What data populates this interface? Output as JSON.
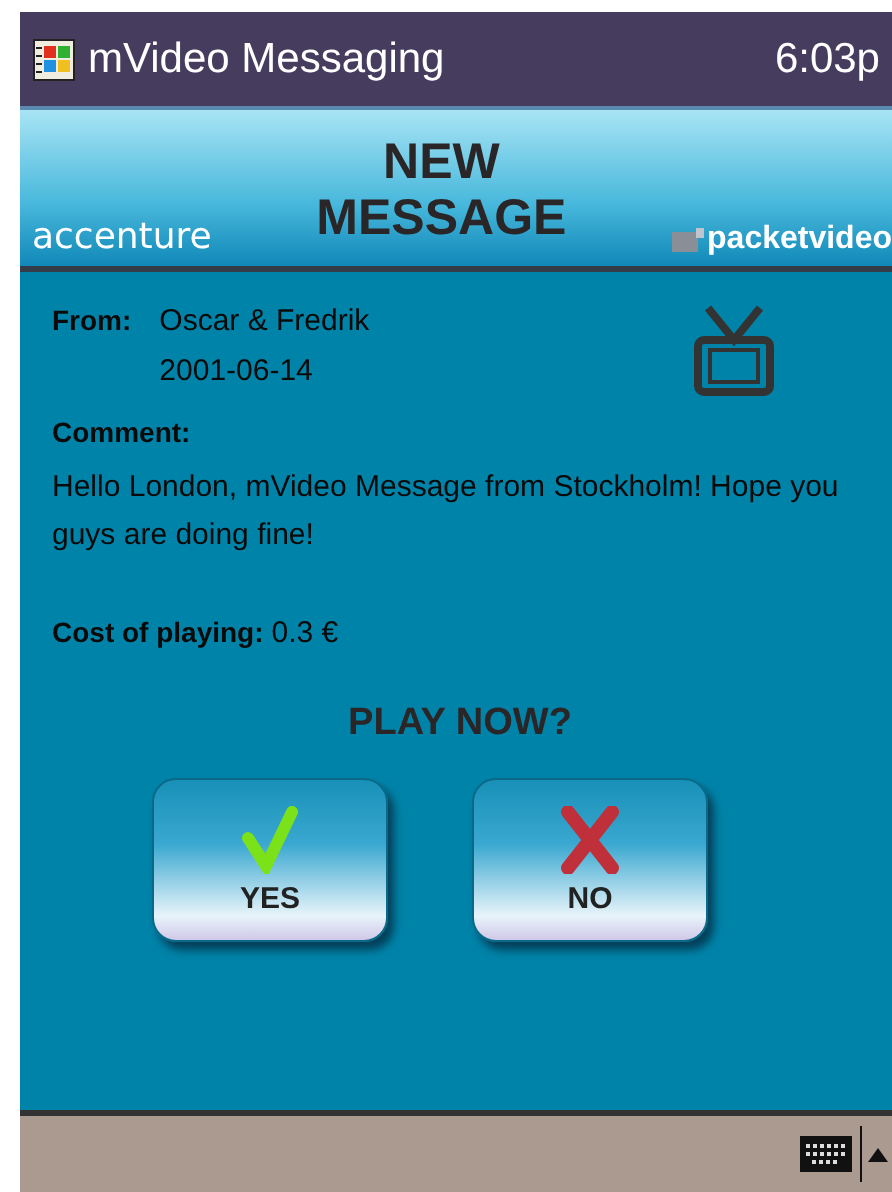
{
  "title_bar": {
    "title": "mVideo Messaging",
    "time": "6:03p"
  },
  "header": {
    "title_lines": [
      "NEW",
      "MESSAGE"
    ],
    "left_logo": "accenture",
    "right_logo": "packetvideo"
  },
  "message": {
    "from_label": "From:",
    "sender": "Oscar & Fredrik",
    "date": "2001-06-14",
    "comment_label": "Comment:",
    "comment": "Hello London, mVideo Message from Stockholm! Hope you guys are doing fine!",
    "cost_label": "Cost of playing:",
    "cost": "0.3 €"
  },
  "prompt": "PLAY NOW?",
  "buttons": [
    {
      "label": "YES",
      "kind": "yes"
    },
    {
      "label": "NO",
      "kind": "no"
    }
  ]
}
